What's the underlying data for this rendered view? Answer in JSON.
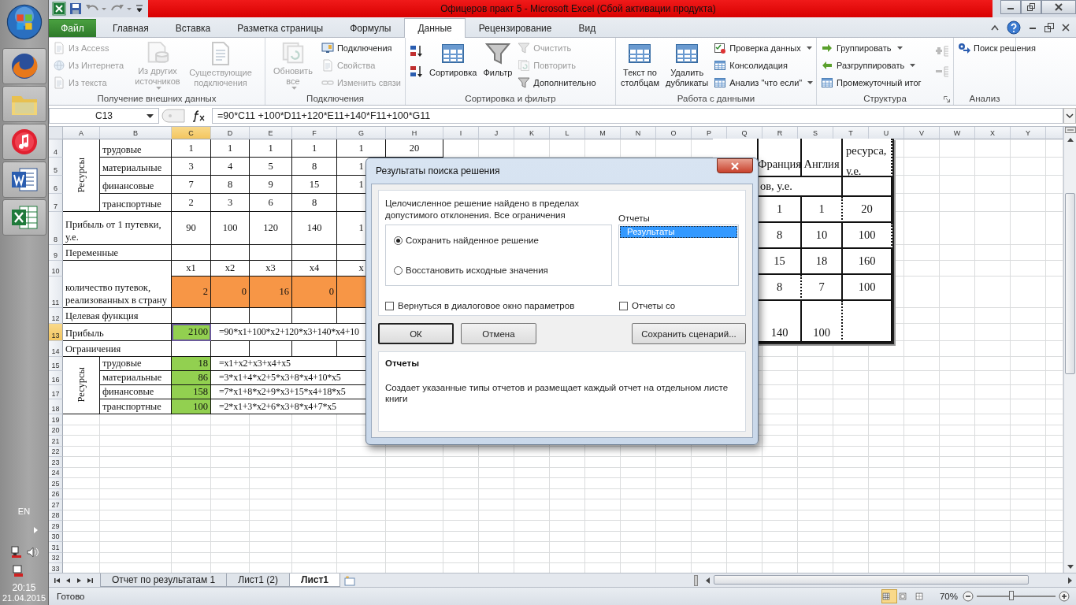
{
  "taskbar": {
    "apps": [
      {
        "kind": "start"
      },
      {
        "kind": "browser"
      },
      {
        "kind": "folder"
      },
      {
        "kind": "music"
      },
      {
        "kind": "word"
      },
      {
        "kind": "excel"
      }
    ],
    "language": "EN",
    "time": "20:15",
    "date": "21.04.2015"
  },
  "window": {
    "title": "Офицеров практ 5 - Microsoft Excel (Сбой активации продукта)"
  },
  "tabs": [
    {
      "label": "Файл",
      "kind": "file",
      "selected": false
    },
    {
      "label": "Главная",
      "kind": "tab",
      "selected": false
    },
    {
      "label": "Вставка",
      "kind": "tab",
      "selected": false
    },
    {
      "label": "Разметка страницы",
      "kind": "tab",
      "selected": false
    },
    {
      "label": "Формулы",
      "kind": "tab",
      "selected": false
    },
    {
      "label": "Данные",
      "kind": "tab",
      "selected": true
    },
    {
      "label": "Рецензирование",
      "kind": "tab",
      "selected": false
    },
    {
      "label": "Вид",
      "kind": "tab",
      "selected": false
    }
  ],
  "ribbon": [
    {
      "label": "Получение внешних данных",
      "launcher": false,
      "columns": [
        {
          "kind": "stack",
          "items": [
            {
              "label": "Из Access",
              "disabled": true,
              "dropdown": false
            },
            {
              "label": "Из Интернета",
              "disabled": true,
              "dropdown": false
            },
            {
              "label": "Из текста",
              "disabled": true,
              "dropdown": false
            }
          ]
        },
        {
          "kind": "large",
          "items": [
            {
              "label": "Из других источников",
              "disabled": true,
              "dropdown": true
            }
          ]
        },
        {
          "kind": "large",
          "items": [
            {
              "label": "Существующие подключения",
              "disabled": true,
              "dropdown": false
            }
          ]
        }
      ]
    },
    {
      "label": "Подключения",
      "launcher": false,
      "columns": [
        {
          "kind": "large",
          "items": [
            {
              "label": "Обновить все",
              "disabled": true,
              "dropdown": true
            }
          ]
        },
        {
          "kind": "stack",
          "items": [
            {
              "label": "Подключения",
              "disabled": false,
              "dropdown": false
            },
            {
              "label": "Свойства",
              "disabled": true,
              "dropdown": false
            },
            {
              "label": "Изменить связи",
              "disabled": true,
              "dropdown": false
            }
          ]
        }
      ]
    },
    {
      "label": "Сортировка и фильтр",
      "launcher": false,
      "columns": [
        {
          "kind": "sort-icons"
        },
        {
          "kind": "large",
          "items": [
            {
              "label": "Сортировка",
              "disabled": false,
              "dropdown": false
            }
          ]
        },
        {
          "kind": "large",
          "items": [
            {
              "label": "Фильтр",
              "disabled": false,
              "dropdown": false
            }
          ]
        },
        {
          "kind": "stack",
          "items": [
            {
              "label": "Очистить",
              "disabled": true,
              "dropdown": false
            },
            {
              "label": "Повторить",
              "disabled": true,
              "dropdown": false
            },
            {
              "label": "Дополнительно",
              "disabled": false,
              "dropdown": false
            }
          ]
        }
      ]
    },
    {
      "label": "Работа с данными",
      "launcher": false,
      "columns": [
        {
          "kind": "large",
          "items": [
            {
              "label": "Текст по столбцам",
              "disabled": false,
              "dropdown": false
            }
          ]
        },
        {
          "kind": "large",
          "items": [
            {
              "label": "Удалить дубликаты",
              "disabled": false,
              "dropdown": false
            }
          ]
        },
        {
          "kind": "stack",
          "items": [
            {
              "label": "Проверка данных",
              "disabled": false,
              "dropdown": true
            },
            {
              "label": "Консолидация",
              "disabled": false,
              "dropdown": false
            },
            {
              "label": "Анализ \"что если\"",
              "disabled": false,
              "dropdown": true
            }
          ]
        }
      ]
    },
    {
      "label": "Структура",
      "launcher": true,
      "columns": [
        {
          "kind": "stack",
          "items": [
            {
              "label": "Группировать",
              "disabled": false,
              "dropdown": true
            },
            {
              "label": "Разгруппировать",
              "disabled": false,
              "dropdown": true
            },
            {
              "label": "Промежуточный итог",
              "disabled": false,
              "dropdown": false
            }
          ]
        },
        {
          "kind": "detail-icons"
        }
      ]
    },
    {
      "label": "Анализ",
      "launcher": false,
      "columns": [
        {
          "kind": "stack",
          "items": [
            {
              "label": "Поиск решения",
              "disabled": false,
              "dropdown": false
            }
          ]
        }
      ]
    }
  ],
  "formula_bar": {
    "name_box": "C13",
    "formula": "=90*C11 +100*D11+120*E11+140*F11+100*G11"
  },
  "sheet": {
    "columns": [
      {
        "label": "A",
        "selected": false
      },
      {
        "label": "B",
        "selected": false
      },
      {
        "label": "C",
        "selected": true
      },
      {
        "label": "D",
        "selected": false
      },
      {
        "label": "E",
        "selected": false
      },
      {
        "label": "F",
        "selected": false
      },
      {
        "label": "G",
        "selected": false
      },
      {
        "label": "H",
        "selected": false
      },
      {
        "label": "I",
        "selected": false
      },
      {
        "label": "J",
        "selected": false
      },
      {
        "label": "K",
        "selected": false
      },
      {
        "label": "L",
        "selected": false
      },
      {
        "label": "M",
        "selected": false
      },
      {
        "label": "N",
        "selected": false
      },
      {
        "label": "O",
        "selected": false
      },
      {
        "label": "P",
        "selected": false
      },
      {
        "label": "Q",
        "selected": false
      },
      {
        "label": "R",
        "selected": false
      },
      {
        "label": "S",
        "selected": false
      },
      {
        "label": "T",
        "selected": false
      },
      {
        "label": "U",
        "selected": false
      },
      {
        "label": "V",
        "selected": false
      },
      {
        "label": "W",
        "selected": false
      },
      {
        "label": "X",
        "selected": false
      },
      {
        "label": "Y",
        "selected": false
      }
    ],
    "rows": [
      {
        "number": "4",
        "selected": false,
        "cells": {
          "A": {
            "kind": "vertical",
            "text": "Ресурсы"
          },
          "B": {
            "text": "трудовые"
          },
          "C": {
            "text": "1"
          },
          "D": {
            "text": "1"
          },
          "E": {
            "text": "1"
          },
          "F": {
            "text": "1"
          },
          "G": {
            "text": "1"
          },
          "H": {
            "text": "20"
          }
        }
      },
      {
        "number": "5",
        "selected": false,
        "cells": {
          "B": {
            "text": "материальные"
          },
          "C": {
            "text": "3"
          },
          "D": {
            "text": "4"
          },
          "E": {
            "text": "5"
          },
          "F": {
            "text": "8"
          },
          "G": {
            "text": "1"
          }
        }
      },
      {
        "number": "6",
        "selected": false,
        "cells": {
          "B": {
            "text": "финансовые"
          },
          "C": {
            "text": "7"
          },
          "D": {
            "text": "8"
          },
          "E": {
            "text": "9"
          },
          "F": {
            "text": "15"
          },
          "G": {
            "text": "1"
          }
        }
      },
      {
        "number": "7",
        "selected": false,
        "cells": {
          "B": {
            "text": "транспортные"
          },
          "C": {
            "text": "2"
          },
          "D": {
            "text": "3"
          },
          "E": {
            "text": "6"
          },
          "F": {
            "text": "8"
          }
        }
      },
      {
        "number": "8",
        "selected": false,
        "cells": {
          "A": {
            "text": "Прибыль от 1 путевки, у.е."
          },
          "C": {
            "text": "90"
          },
          "D": {
            "text": "100"
          },
          "E": {
            "text": "120"
          },
          "F": {
            "text": "140"
          },
          "G": {
            "text": "1"
          }
        }
      },
      {
        "number": "9",
        "selected": false,
        "cells": {
          "A": {
            "text": "Переменные"
          }
        }
      },
      {
        "number": "10",
        "selected": false,
        "cells": {
          "A": {
            "text": "количество путевок, реализованных в страну"
          },
          "C": {
            "text": "x1"
          },
          "D": {
            "text": "x2"
          },
          "E": {
            "text": "x3"
          },
          "F": {
            "text": "x4"
          },
          "G": {
            "text": "x"
          }
        }
      },
      {
        "number": "11",
        "selected": false,
        "cells": {
          "C": {
            "text": "2",
            "color": "#f79646"
          },
          "D": {
            "text": "0",
            "color": "#f79646"
          },
          "E": {
            "text": "16",
            "color": "#f79646"
          },
          "F": {
            "text": "0",
            "color": "#f79646"
          },
          "G": {
            "color": "#f79646"
          }
        }
      },
      {
        "number": "12",
        "selected": false,
        "cells": {
          "A": {
            "text": "Целевая функция"
          }
        }
      },
      {
        "number": "13",
        "selected": true,
        "cells": {
          "A": {
            "text": "Прибыль"
          },
          "C": {
            "text": "2100",
            "color": "#92d050"
          },
          "D": {
            "kind": "formula",
            "text": "=90*x1+100*x2+120*x3+140*x4+10"
          }
        }
      },
      {
        "number": "14",
        "selected": false,
        "cells": {
          "A": {
            "text": "Ограничения"
          }
        }
      },
      {
        "number": "15",
        "selected": false,
        "cells": {
          "A": {
            "kind": "vertical",
            "text": "Ресурсы"
          },
          "B": {
            "text": "трудовые"
          },
          "C": {
            "text": "18",
            "color": "#92d050"
          },
          "D": {
            "kind": "formula",
            "text": "=x1+x2+x3+x4+x5"
          }
        }
      },
      {
        "number": "16",
        "selected": false,
        "cells": {
          "B": {
            "text": "материальные"
          },
          "C": {
            "text": "86",
            "color": "#92d050"
          },
          "D": {
            "kind": "formula",
            "text": "=3*x1+4*x2+5*x3+8*x4+10*x5"
          }
        }
      },
      {
        "number": "17",
        "selected": false,
        "cells": {
          "B": {
            "text": "финансовые"
          },
          "C": {
            "text": "158",
            "color": "#92d050"
          },
          "D": {
            "kind": "formula",
            "text": "=7*x1+8*x2+9*x3+15*x4+18*x5"
          }
        }
      },
      {
        "number": "18",
        "selected": false,
        "cells": {
          "B": {
            "text": "транспортные"
          },
          "C": {
            "text": "100",
            "color": "#92d050"
          },
          "D": {
            "kind": "formula",
            "text": "=2*x1+3*x2+6*x3+8*x4+7*x5"
          }
        }
      },
      {
        "number": "19",
        "selected": false
      },
      {
        "number": "20",
        "selected": false
      },
      {
        "number": "21",
        "selected": false
      },
      {
        "number": "22",
        "selected": false
      },
      {
        "number": "23",
        "selected": false
      },
      {
        "number": "24",
        "selected": false
      },
      {
        "number": "25",
        "selected": false
      },
      {
        "number": "26",
        "selected": false
      },
      {
        "number": "27",
        "selected": false
      },
      {
        "number": "28",
        "selected": false
      },
      {
        "number": "29",
        "selected": false
      },
      {
        "number": "30",
        "selected": false
      },
      {
        "number": "31",
        "selected": false
      },
      {
        "number": "32",
        "selected": false
      },
      {
        "number": "33",
        "selected": false
      }
    ],
    "pasted_table": {
      "headers": [
        "Франция",
        "Англия",
        "ресурса, у.е."
      ],
      "subheader": "ов, у.е.",
      "rows": [
        [
          "1",
          "1",
          "20"
        ],
        [
          "8",
          "10",
          "100"
        ],
        [
          "15",
          "18",
          "160"
        ],
        [
          "8",
          "7",
          "100"
        ],
        [
          "140",
          "100"
        ]
      ]
    }
  },
  "dialog": {
    "title": "Результаты поиска решения",
    "message": "Целочисленное решение найдено в пределах допустимого отклонения. Все ограничения",
    "options": [
      {
        "label": "Сохранить найденное решение",
        "selected": true
      },
      {
        "label": "Восстановить исходные значения",
        "selected": false
      }
    ],
    "reports_label": "Отчеты",
    "reports": [
      {
        "label": "Результаты",
        "selected": true
      }
    ],
    "checkboxes": [
      {
        "label": "Вернуться в диалоговое окно параметров",
        "checked": false
      },
      {
        "label": "Отчеты со",
        "checked": false
      }
    ],
    "buttons": [
      {
        "label": "ОК",
        "default": true
      },
      {
        "label": "Отмена",
        "default": false
      },
      {
        "label": "Сохранить сценарий...",
        "default": false
      }
    ],
    "description": {
      "title": "Отчеты",
      "text": "Создает указанные типы отчетов и размещает каждый отчет на отдельном листе книги"
    }
  },
  "sheet_tabs": [
    {
      "label": "Отчет по результатам 1",
      "selected": false
    },
    {
      "label": "Лист1 (2)",
      "selected": false
    },
    {
      "label": "Лист1",
      "selected": true
    }
  ],
  "status_bar": {
    "status": "Готово",
    "views": [
      {
        "selected": true
      },
      {
        "selected": false
      },
      {
        "selected": false
      }
    ],
    "zoom": {
      "label": "70%",
      "level": 0.44
    }
  }
}
